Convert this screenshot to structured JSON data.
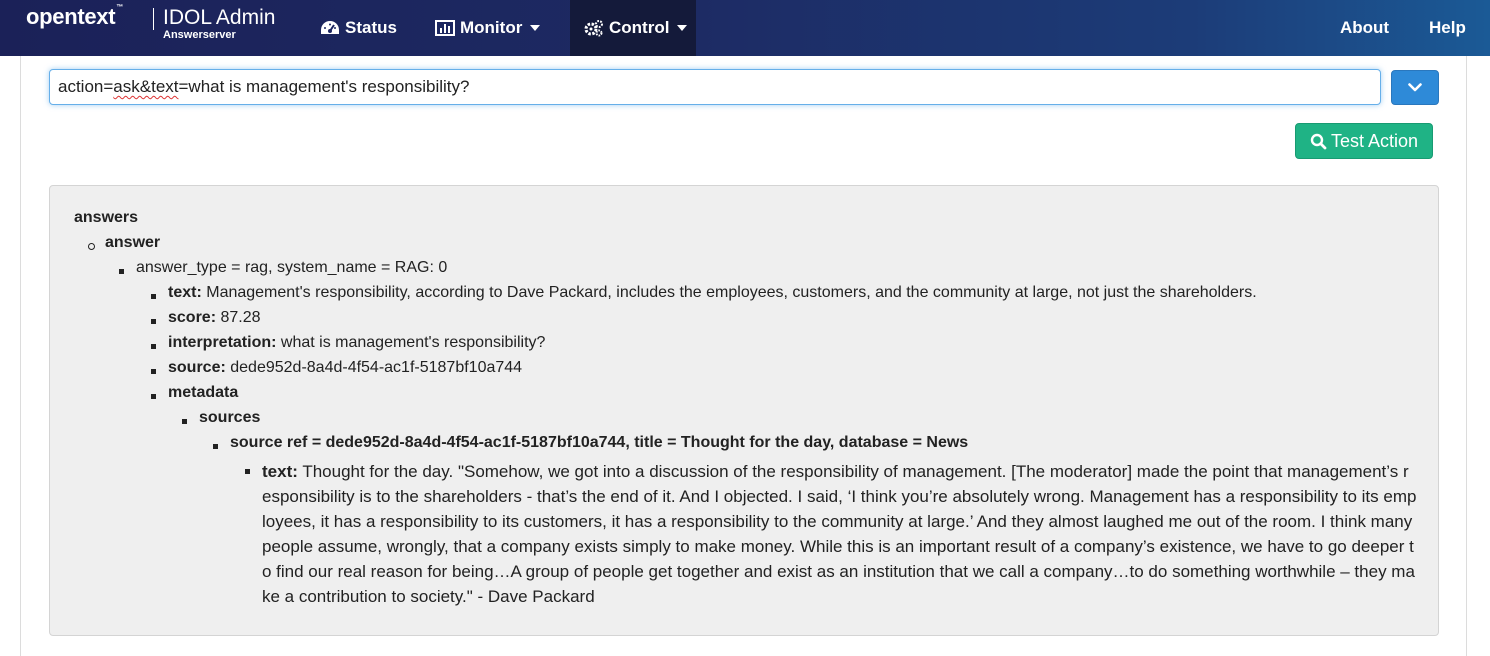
{
  "navbar": {
    "brand_logo": "opentext",
    "brand_tm": "™",
    "brand_title": "IDOL Admin",
    "brand_subtitle": "Answerserver",
    "items": [
      {
        "label": "Status",
        "icon": "dashboard-icon"
      },
      {
        "label": "Monitor",
        "icon": "bar-chart-icon"
      },
      {
        "label": "Control",
        "icon": "gears-icon"
      }
    ],
    "right_items": [
      {
        "label": "About"
      },
      {
        "label": "Help"
      }
    ]
  },
  "query": {
    "value_prefix": "action=",
    "value_misspelled": "ask&text",
    "value_suffix": "=what is management's responsibility?"
  },
  "test_button": {
    "label": "Test Action",
    "icon": "search-icon"
  },
  "colors": {
    "navbar_active": "#141a3a",
    "dropdown_button": "#2e8ad8",
    "test_button": "#1fb385",
    "panel_background": "#efefef"
  },
  "result": {
    "root": "answers",
    "answer": "answer",
    "answer_meta": "answer_type = rag, system_name = RAG: 0",
    "fields": [
      {
        "key": "text:",
        "value": "Management's responsibility, according to Dave Packard, includes the employees, customers, and the community at large, not just the shareholders."
      },
      {
        "key": "score:",
        "value": "87.28"
      },
      {
        "key": "interpretation:",
        "value": "what is management's responsibility?"
      },
      {
        "key": "source:",
        "value": "dede952d-8a4d-4f54-ac1f-5187bf10a744"
      }
    ],
    "metadata": "metadata",
    "sources": "sources",
    "source_ref": "source ref = dede952d-8a4d-4f54-ac1f-5187bf10a744, title = Thought for the day, database = News",
    "source_text_key": "text:",
    "source_text_value": "Thought for the day. \"Somehow, we got into a discussion of the responsibility of management. [The moderator] made the point that management’s responsibility is to the shareholders - that’s the end of it. And I objected. I said, ‘I think you’re absolutely wrong. Management has a responsibility to its employees, it has a responsibility to its customers, it has a responsibility to the community at large.’ And they almost laughed me out of the room. I think many people assume, wrongly, that a company exists simply to make money. While this is an important result of a company’s existence, we have to go deeper to find our real reason for being…A group of people get together and exist as an institution that we call a company…to do something worthwhile – they make a contribution to society.\" - Dave Packard"
  }
}
